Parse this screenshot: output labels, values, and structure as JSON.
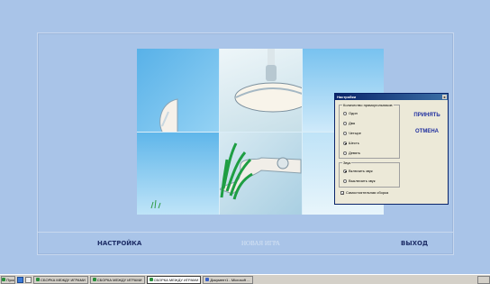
{
  "app": {
    "nav": {
      "settings": "НАСТРОЙКА",
      "new_game": "НОВАЯ ИГРА",
      "exit": "ВЫХОД"
    }
  },
  "dialog": {
    "title": "Настройки",
    "close": "x",
    "pieces_group": "Количество прямоугольников",
    "pieces_options": [
      "Один",
      "Два",
      "Четыре",
      "Шесть",
      "Девять"
    ],
    "sound_group": "Звук",
    "sound_options": [
      "Включить звук",
      "Выключить звук"
    ],
    "auto_assemble": "Самостоятельная сборка",
    "apply": "ПРИНЯТЬ",
    "cancel": "ОТМЕНА"
  },
  "taskbar": {
    "start": "Пуск",
    "tasks": [
      "СБОРКА МЕЖДУ ИГРАМИ",
      "СБОРКА МЕЖДУ ИГРАМИ",
      "СБОРКА МЕЖДУ ИГРАМИ",
      "Документ1 - Microsoft ..."
    ]
  },
  "colors": {
    "background": "#a9c4e8",
    "nav_text": "#1f2f68",
    "dialog_title": "#0a246a"
  }
}
